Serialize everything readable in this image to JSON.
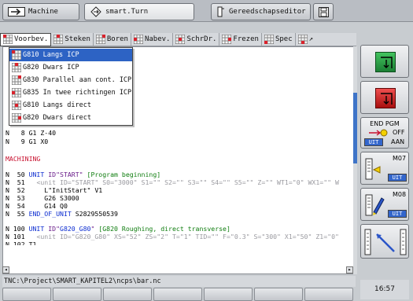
{
  "tabs": [
    {
      "label": "Machine",
      "icon": "machine-arrow-icon"
    },
    {
      "label": "smart.Turn",
      "icon": "smart-turn-icon"
    },
    {
      "label": "Gereedschapseditor",
      "icon": "tool-editor-icon"
    },
    {
      "label": "",
      "icon": "save-disk-icon"
    }
  ],
  "menubar": [
    "Voorbev.",
    "Steken",
    "Boren",
    "Nabev.",
    "SchrDr.",
    "Frezen",
    "Spec",
    "↗"
  ],
  "dropdown": [
    "G810 Langs ICP",
    "G820 Dwars ICP",
    "G830 Parallel aan cont. ICP",
    "G835 In twee richtingen ICP",
    "G810 Langs direct",
    "G820 Dwars direct"
  ],
  "code": {
    "l8": "N   8 G1 Z-40",
    "l9": "N   9 G1 X0",
    "machining": "MACHINING",
    "l50_n": "N  50 ",
    "l50_unit": "UNIT",
    "l50_id": " ID\"START\"",
    "l50_cmt": " [Program beginning]",
    "l51_n": "N  51   ",
    "l51_rest": "<unit ID=\"START\" S0=\"3000\" S1=\"\" S2=\"\" S3=\"\" S4=\"\" S5=\"\" Z=\"\" WT1=\"0\" WX1=\"\" W",
    "l52": "N  52     L\"InitStart\" V1",
    "l53": "N  53     G26 S3000",
    "l54": "N  54     G14 Q0",
    "l55_n": "N  55 ",
    "l55_kw": "END_OF_UNIT",
    "l55_rest": " S2829550539",
    "l100_n": "N 100 ",
    "l100_unit": "UNIT",
    "l100_id": " ID\"",
    "l100_idv": "G820_G80",
    "l100_idq": "\"",
    "l100_cmt": " [G820 Roughing, direct transverse]",
    "l101_n": "N 101   ",
    "l101_rest": "<unit ID=\"G820_G80\" XS=\"52\" ZS=\"2\" T=\"1\" TID=\"\" F=\"0.3\" S=\"300\" X1=\"50\" Z1=\"0\"",
    "l102": "N 102 T1"
  },
  "status_path": "TNC:\\Project\\SMART_KAPITEL2\\ncps\\bar.nc",
  "side": {
    "end_pgm": "END PGM",
    "off": "OFF",
    "uit1": "UIT",
    "aan": "AAN",
    "m07": "M07",
    "uit2": "UIT",
    "m08": "M08",
    "uit3": "UIT"
  },
  "clock": "16:57",
  "colors": {
    "accent": "#2d63c4",
    "keyword": "#0a2bd0",
    "comment": "#0f7d0f",
    "red": "#c8102e"
  }
}
